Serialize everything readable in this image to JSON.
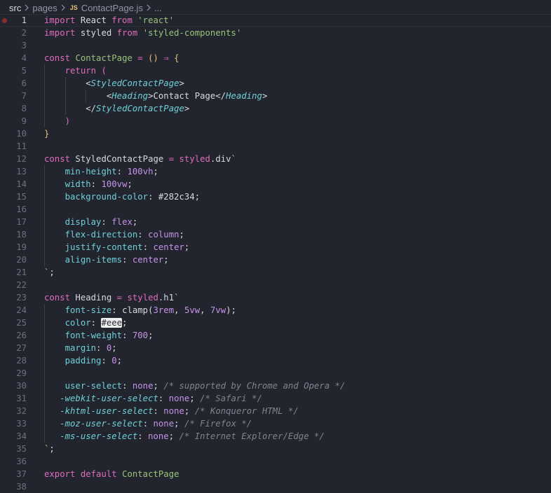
{
  "breadcrumb": {
    "root": "src",
    "folder": "pages",
    "file_badge": "JS",
    "file": "ContactPage.js",
    "more": "..."
  },
  "colors": {
    "background": "#22252e",
    "keyword": "#e06cbe",
    "string": "#98c379",
    "property": "#6fd0d8",
    "number": "#c792ea",
    "comment": "#7f848e",
    "breakpoint": "#8b2c2c"
  },
  "editor": {
    "current_line": 1,
    "breakpoint_line": 1,
    "lines": [
      {
        "n": "1",
        "indent": 0,
        "tokens": [
          {
            "c": "kw",
            "t": "import"
          },
          {
            "c": "text",
            "t": " React "
          },
          {
            "c": "kw",
            "t": "from"
          },
          {
            "c": "text",
            "t": " "
          },
          {
            "c": "str",
            "t": "'react'"
          }
        ]
      },
      {
        "n": "2",
        "indent": 0,
        "tokens": [
          {
            "c": "kw",
            "t": "import"
          },
          {
            "c": "text",
            "t": " styled "
          },
          {
            "c": "kw",
            "t": "from"
          },
          {
            "c": "text",
            "t": " "
          },
          {
            "c": "str",
            "t": "'styled-components'"
          }
        ]
      },
      {
        "n": "3",
        "indent": 0,
        "tokens": []
      },
      {
        "n": "4",
        "indent": 0,
        "tokens": [
          {
            "c": "kw",
            "t": "const"
          },
          {
            "c": "text",
            "t": " "
          },
          {
            "c": "fn",
            "t": "ContactPage"
          },
          {
            "c": "text",
            "t": " "
          },
          {
            "c": "kw",
            "t": "="
          },
          {
            "c": "text",
            "t": " "
          },
          {
            "c": "brk",
            "t": "()"
          },
          {
            "c": "text",
            "t": " "
          },
          {
            "c": "kw",
            "t": "⇒"
          },
          {
            "c": "text",
            "t": " "
          },
          {
            "c": "brk",
            "t": "{"
          }
        ]
      },
      {
        "n": "5",
        "indent": 1,
        "tokens": [
          {
            "c": "text",
            "t": "    "
          },
          {
            "c": "kw",
            "t": "return"
          },
          {
            "c": "text",
            "t": " "
          },
          {
            "c": "brk2",
            "t": "("
          }
        ]
      },
      {
        "n": "6",
        "indent": 2,
        "tokens": [
          {
            "c": "text",
            "t": "        <"
          },
          {
            "c": "tag",
            "t": "StyledContactPage"
          },
          {
            "c": "text",
            "t": ">"
          }
        ]
      },
      {
        "n": "7",
        "indent": 3,
        "tokens": [
          {
            "c": "text",
            "t": "            <"
          },
          {
            "c": "tag",
            "t": "Heading"
          },
          {
            "c": "text",
            "t": ">Contact Page</"
          },
          {
            "c": "tag",
            "t": "Heading"
          },
          {
            "c": "text",
            "t": ">"
          }
        ]
      },
      {
        "n": "8",
        "indent": 2,
        "tokens": [
          {
            "c": "text",
            "t": "        </"
          },
          {
            "c": "tag",
            "t": "StyledContactPage"
          },
          {
            "c": "text",
            "t": ">"
          }
        ]
      },
      {
        "n": "9",
        "indent": 1,
        "tokens": [
          {
            "c": "text",
            "t": "    "
          },
          {
            "c": "brk2",
            "t": ")"
          }
        ]
      },
      {
        "n": "10",
        "indent": 0,
        "tokens": [
          {
            "c": "brk",
            "t": "}"
          }
        ]
      },
      {
        "n": "11",
        "indent": 0,
        "tokens": []
      },
      {
        "n": "12",
        "indent": 0,
        "tokens": [
          {
            "c": "kw",
            "t": "const"
          },
          {
            "c": "text",
            "t": " StyledContactPage "
          },
          {
            "c": "kw",
            "t": "="
          },
          {
            "c": "text",
            "t": " "
          },
          {
            "c": "kw",
            "t": "styled"
          },
          {
            "c": "text",
            "t": ".div"
          },
          {
            "c": "tick",
            "t": "`"
          }
        ]
      },
      {
        "n": "13",
        "indent": 1,
        "tokens": [
          {
            "c": "text",
            "t": "    "
          },
          {
            "c": "prop",
            "t": "min-height"
          },
          {
            "c": "text",
            "t": ": "
          },
          {
            "c": "num",
            "t": "100vh"
          },
          {
            "c": "text",
            "t": ";"
          }
        ]
      },
      {
        "n": "14",
        "indent": 1,
        "tokens": [
          {
            "c": "text",
            "t": "    "
          },
          {
            "c": "prop",
            "t": "width"
          },
          {
            "c": "text",
            "t": ": "
          },
          {
            "c": "num",
            "t": "100vw"
          },
          {
            "c": "text",
            "t": ";"
          }
        ]
      },
      {
        "n": "15",
        "indent": 1,
        "tokens": [
          {
            "c": "text",
            "t": "    "
          },
          {
            "c": "prop",
            "t": "background-color"
          },
          {
            "c": "text",
            "t": ": #282c34;"
          }
        ]
      },
      {
        "n": "16",
        "indent": 1,
        "tokens": []
      },
      {
        "n": "17",
        "indent": 1,
        "tokens": [
          {
            "c": "text",
            "t": "    "
          },
          {
            "c": "prop",
            "t": "display"
          },
          {
            "c": "text",
            "t": ": "
          },
          {
            "c": "val",
            "t": "flex"
          },
          {
            "c": "text",
            "t": ";"
          }
        ]
      },
      {
        "n": "18",
        "indent": 1,
        "tokens": [
          {
            "c": "text",
            "t": "    "
          },
          {
            "c": "prop",
            "t": "flex-direction"
          },
          {
            "c": "text",
            "t": ": "
          },
          {
            "c": "val",
            "t": "column"
          },
          {
            "c": "text",
            "t": ";"
          }
        ]
      },
      {
        "n": "19",
        "indent": 1,
        "tokens": [
          {
            "c": "text",
            "t": "    "
          },
          {
            "c": "prop",
            "t": "justify-content"
          },
          {
            "c": "text",
            "t": ": "
          },
          {
            "c": "val",
            "t": "center"
          },
          {
            "c": "text",
            "t": ";"
          }
        ]
      },
      {
        "n": "20",
        "indent": 1,
        "tokens": [
          {
            "c": "text",
            "t": "    "
          },
          {
            "c": "prop",
            "t": "align-items"
          },
          {
            "c": "text",
            "t": ": "
          },
          {
            "c": "val",
            "t": "center"
          },
          {
            "c": "text",
            "t": ";"
          }
        ]
      },
      {
        "n": "21",
        "indent": 0,
        "tokens": [
          {
            "c": "tick",
            "t": "`"
          },
          {
            "c": "text",
            "t": ";"
          }
        ]
      },
      {
        "n": "22",
        "indent": 0,
        "tokens": []
      },
      {
        "n": "23",
        "indent": 0,
        "tokens": [
          {
            "c": "kw",
            "t": "const"
          },
          {
            "c": "text",
            "t": " Heading "
          },
          {
            "c": "kw",
            "t": "="
          },
          {
            "c": "text",
            "t": " "
          },
          {
            "c": "kw",
            "t": "styled"
          },
          {
            "c": "text",
            "t": ".h1"
          },
          {
            "c": "tick",
            "t": "`"
          }
        ]
      },
      {
        "n": "24",
        "indent": 1,
        "tokens": [
          {
            "c": "text",
            "t": "    "
          },
          {
            "c": "prop",
            "t": "font-size"
          },
          {
            "c": "text",
            "t": ": clamp("
          },
          {
            "c": "num",
            "t": "3rem"
          },
          {
            "c": "text",
            "t": ", "
          },
          {
            "c": "num",
            "t": "5vw"
          },
          {
            "c": "text",
            "t": ", "
          },
          {
            "c": "num",
            "t": "7vw"
          },
          {
            "c": "text",
            "t": ");"
          }
        ]
      },
      {
        "n": "25",
        "indent": 1,
        "tokens": [
          {
            "c": "text",
            "t": "    "
          },
          {
            "c": "prop",
            "t": "color"
          },
          {
            "c": "text",
            "t": ": "
          },
          {
            "c": "hex",
            "t": "#eee"
          },
          {
            "c": "text",
            "t": ";"
          }
        ]
      },
      {
        "n": "26",
        "indent": 1,
        "tokens": [
          {
            "c": "text",
            "t": "    "
          },
          {
            "c": "prop",
            "t": "font-weight"
          },
          {
            "c": "text",
            "t": ": "
          },
          {
            "c": "num",
            "t": "700"
          },
          {
            "c": "text",
            "t": ";"
          }
        ]
      },
      {
        "n": "27",
        "indent": 1,
        "tokens": [
          {
            "c": "text",
            "t": "    "
          },
          {
            "c": "prop",
            "t": "margin"
          },
          {
            "c": "text",
            "t": ": "
          },
          {
            "c": "num",
            "t": "0"
          },
          {
            "c": "text",
            "t": ";"
          }
        ]
      },
      {
        "n": "28",
        "indent": 1,
        "tokens": [
          {
            "c": "text",
            "t": "    "
          },
          {
            "c": "prop",
            "t": "padding"
          },
          {
            "c": "text",
            "t": ": "
          },
          {
            "c": "num",
            "t": "0"
          },
          {
            "c": "text",
            "t": ";"
          }
        ]
      },
      {
        "n": "29",
        "indent": 1,
        "tokens": []
      },
      {
        "n": "30",
        "indent": 1,
        "tokens": [
          {
            "c": "text",
            "t": "    "
          },
          {
            "c": "prop",
            "t": "user-select"
          },
          {
            "c": "text",
            "t": ": "
          },
          {
            "c": "val",
            "t": "none"
          },
          {
            "c": "text",
            "t": "; "
          },
          {
            "c": "com",
            "t": "/* supported by Chrome and Opera */"
          }
        ]
      },
      {
        "n": "31",
        "indent": 1,
        "tokens": [
          {
            "c": "text",
            "t": "   "
          },
          {
            "c": "vend",
            "t": "-webkit-user-select"
          },
          {
            "c": "text",
            "t": ": "
          },
          {
            "c": "val",
            "t": "none"
          },
          {
            "c": "text",
            "t": "; "
          },
          {
            "c": "com",
            "t": "/* Safari */"
          }
        ]
      },
      {
        "n": "32",
        "indent": 1,
        "tokens": [
          {
            "c": "text",
            "t": "   "
          },
          {
            "c": "vend",
            "t": "-khtml-user-select"
          },
          {
            "c": "text",
            "t": ": "
          },
          {
            "c": "val",
            "t": "none"
          },
          {
            "c": "text",
            "t": "; "
          },
          {
            "c": "com",
            "t": "/* Konqueror HTML */"
          }
        ]
      },
      {
        "n": "33",
        "indent": 1,
        "tokens": [
          {
            "c": "text",
            "t": "   "
          },
          {
            "c": "vend",
            "t": "-moz-user-select"
          },
          {
            "c": "text",
            "t": ": "
          },
          {
            "c": "val",
            "t": "none"
          },
          {
            "c": "text",
            "t": "; "
          },
          {
            "c": "com",
            "t": "/* Firefox */"
          }
        ]
      },
      {
        "n": "34",
        "indent": 1,
        "tokens": [
          {
            "c": "text",
            "t": "   "
          },
          {
            "c": "vend",
            "t": "-ms-user-select"
          },
          {
            "c": "text",
            "t": ": "
          },
          {
            "c": "val",
            "t": "none"
          },
          {
            "c": "text",
            "t": "; "
          },
          {
            "c": "com",
            "t": "/* Internet Explorer/Edge */"
          }
        ]
      },
      {
        "n": "35",
        "indent": 0,
        "tokens": [
          {
            "c": "tick",
            "t": "`"
          },
          {
            "c": "text",
            "t": ";"
          }
        ]
      },
      {
        "n": "36",
        "indent": 0,
        "tokens": []
      },
      {
        "n": "37",
        "indent": 0,
        "tokens": [
          {
            "c": "kw",
            "t": "export"
          },
          {
            "c": "text",
            "t": " "
          },
          {
            "c": "kw",
            "t": "default"
          },
          {
            "c": "text",
            "t": " "
          },
          {
            "c": "fn",
            "t": "ContactPage"
          }
        ]
      },
      {
        "n": "38",
        "indent": 0,
        "tokens": []
      }
    ]
  }
}
